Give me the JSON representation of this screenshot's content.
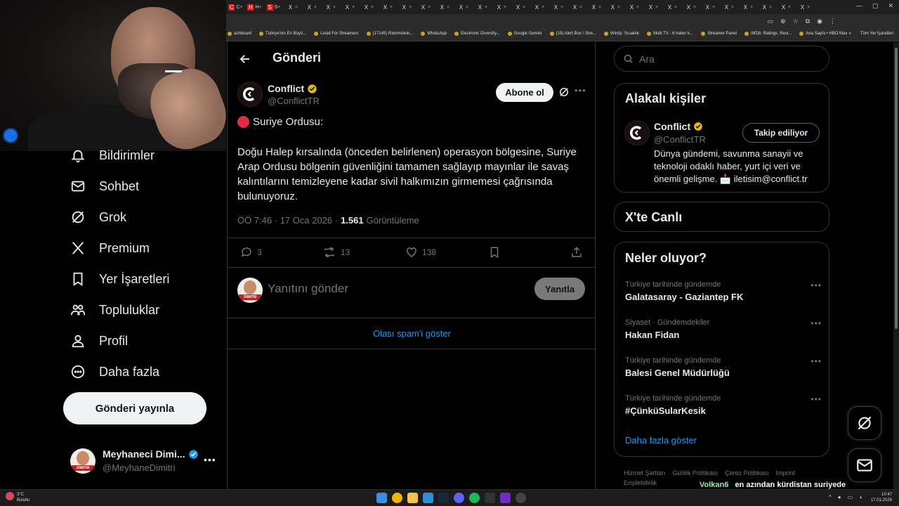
{
  "browser": {
    "tabs": [
      {
        "favicon": "C",
        "label": "C",
        "color": "#d31b1b"
      },
      {
        "favicon": "H",
        "label": "H",
        "color": "#d31b1b"
      },
      {
        "favicon": "S",
        "label": "S",
        "color": "#d31b1b"
      },
      {
        "favicon": "X",
        "label": ""
      },
      {
        "favicon": "X",
        "label": ""
      },
      {
        "favicon": "X",
        "label": ""
      },
      {
        "favicon": "X",
        "label": ""
      },
      {
        "favicon": "X",
        "label": ""
      },
      {
        "favicon": "X",
        "label": ""
      },
      {
        "favicon": "X",
        "label": ""
      },
      {
        "favicon": "X",
        "label": ""
      },
      {
        "favicon": "X",
        "label": ""
      },
      {
        "favicon": "X",
        "label": ""
      },
      {
        "favicon": "X",
        "label": ""
      },
      {
        "favicon": "X",
        "label": ""
      },
      {
        "favicon": "X",
        "label": ""
      },
      {
        "favicon": "X",
        "label": ""
      },
      {
        "favicon": "X",
        "label": ""
      },
      {
        "favicon": "X",
        "label": ""
      },
      {
        "favicon": "X",
        "label": ""
      },
      {
        "favicon": "X",
        "label": ""
      },
      {
        "favicon": "X",
        "label": ""
      },
      {
        "favicon": "X",
        "label": ""
      },
      {
        "favicon": "X",
        "label": ""
      },
      {
        "favicon": "X",
        "label": ""
      },
      {
        "favicon": "X",
        "label": ""
      },
      {
        "favicon": "X",
        "label": ""
      },
      {
        "favicon": "X",
        "label": ""
      },
      {
        "favicon": "X",
        "label": ""
      },
      {
        "favicon": "X",
        "label": ""
      },
      {
        "favicon": "X",
        "label": ""
      }
    ],
    "bookmarks": [
      "ashboard",
      "Türkiye'nin En Büyü...",
      "Livad For Streamers",
      "(17145) Rammstein...",
      "WhatsApp",
      "Electronic Diversity...",
      "Google Gemini",
      "(19) Alert Box / Stre...",
      "Windy: Sıcaklık",
      "Multi TV - 6 haber k...",
      "Streamer Panel",
      "IMDb: Ratings, Revi...",
      "Ana Sayfa • HBO Max"
    ],
    "bookmarks_more": "»",
    "all_bookmarks": "Tüm Yer İşaretleri"
  },
  "nav": {
    "items": [
      {
        "label": "Bildirimler",
        "icon": "bell-icon"
      },
      {
        "label": "Sohbet",
        "icon": "envelope-icon"
      },
      {
        "label": "Grok",
        "icon": "grok-icon"
      },
      {
        "label": "Premium",
        "icon": "x-logo-icon"
      },
      {
        "label": "Yer İşaretleri",
        "icon": "bookmark-icon"
      },
      {
        "label": "Topluluklar",
        "icon": "people-icon"
      },
      {
        "label": "Profil",
        "icon": "person-icon"
      },
      {
        "label": "Daha fazla",
        "icon": "more-circle-icon"
      }
    ],
    "post_button": "Gönderi yayınla",
    "account": {
      "name": "Meyhaneci Dimi...",
      "handle": "@MeyhaneDimitri",
      "avatar_band": "DIMITRI",
      "more": "•••"
    }
  },
  "main": {
    "title": "Gönderi",
    "tweet": {
      "author": "Conflict",
      "handle": "@ConflictTR",
      "subscribe": "Abone ol",
      "more": "•••",
      "line1": "Suriye Ordusu:",
      "body": "Doğu Halep kırsalında (önceden belirlenen) operasyon bölgesine, Suriye Arap Ordusu bölgenin güvenliğini tamamen sağlayıp mayınlar ile savaş kalıntılarını temizleyene kadar sivil halkımızın girmemesi çağrısında bulunuyoruz.",
      "time": "ÖÖ 7:46 · 17 Oca 2026 ·",
      "views": "1.561",
      "views_label": "Görüntüleme",
      "replies": "3",
      "reposts": "13",
      "likes": "138"
    },
    "reply": {
      "placeholder": "Yanıtını gönder",
      "button": "Yanıtla"
    },
    "spam_link": "Olası spam'i göster"
  },
  "sidebar": {
    "search_placeholder": "Ara",
    "related": {
      "title": "Alakalı kişiler",
      "name": "Conflict",
      "handle": "@ConflictTR",
      "follow": "Takip ediliyor",
      "bio": "Dünya gündemi, savunma sanayii ve teknoloji odaklı haber, yurt içi veri ve önemli gelişme. 📩 iletisim@conflict.tr"
    },
    "live_title": "X'te Canlı",
    "trending": {
      "title": "Neler oluyor?",
      "items": [
        {
          "context": "Türkiye tarihinde gündemde",
          "name": "Galatasaray - Gaziantep FK"
        },
        {
          "context": "Siyaset · Gündemdekiler",
          "name": "Hakan Fidan"
        },
        {
          "context": "Türkiye tarihinde gündemde",
          "name": "Balesi Genel Müdürlüğü"
        },
        {
          "context": "Türkiye tarihinde gündemde",
          "name": "#ÇünküSularKesik"
        }
      ],
      "show_more": "Daha fazla göster"
    },
    "footer": [
      "Hizmet Şartları",
      "Gizlilik Politikası",
      "Çerez Politikası",
      "Imprint",
      "Erişilebilirlik"
    ]
  },
  "overlay": {
    "chat_user": "Volkan6",
    "chat_message": "en azından kürdistan suriyede kurulmaya başlandı"
  },
  "taskbar": {
    "temperature": "3°C",
    "weather": "Bulutlu",
    "time": "10:47",
    "date": "17.01.2026"
  },
  "colors": {
    "accent": "#1d9bf0",
    "verified_gold": "#e2b719",
    "verified_blue": "#1d9bf0",
    "background": "#000000",
    "border": "#2f3336"
  }
}
